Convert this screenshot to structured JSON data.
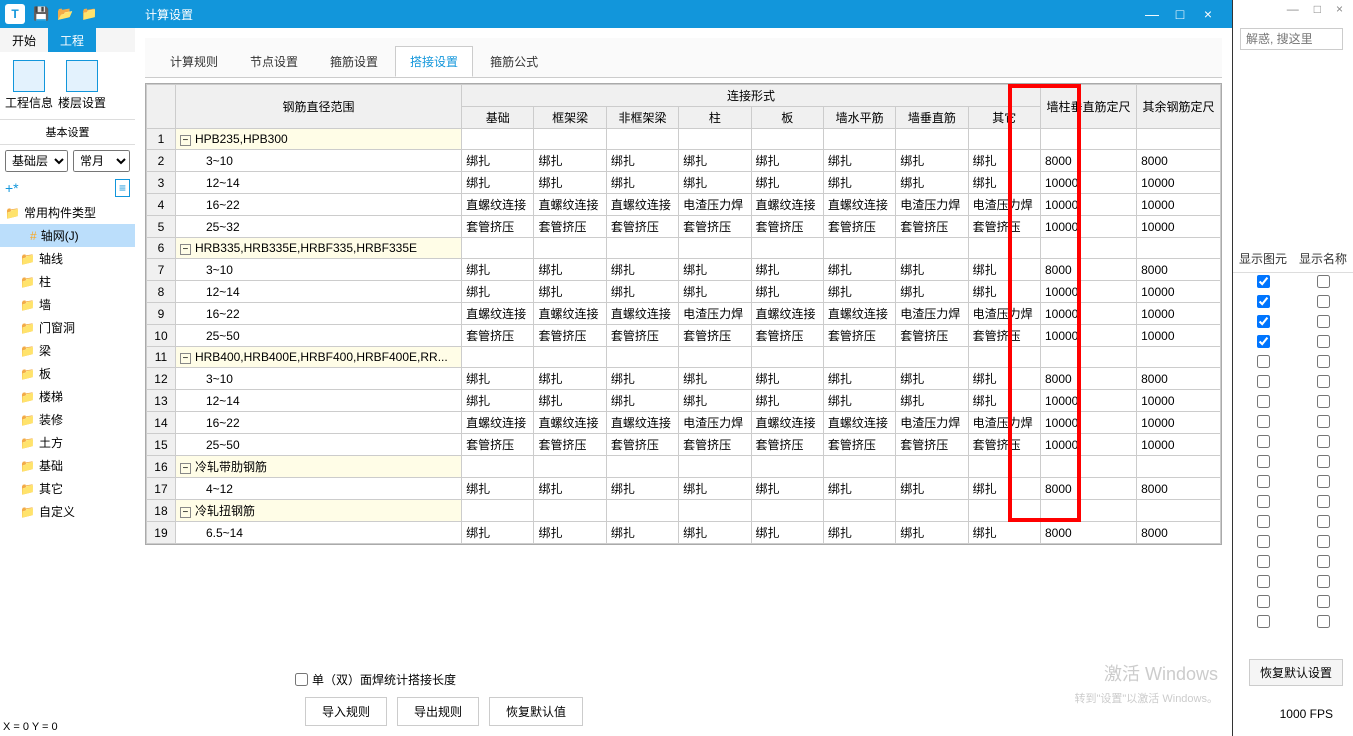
{
  "bg": {
    "min": "—",
    "max": "□",
    "close": "×",
    "search_placeholder": "解惑, 搜这里",
    "rp_col1": "显示图元",
    "rp_col2": "显示名称",
    "restore": "恢复默认设置",
    "fps": "1000 FPS"
  },
  "left": {
    "tabs": [
      "开始",
      "工程"
    ],
    "toolbar": [
      {
        "label": "工程信息"
      },
      {
        "label": "楼层设置"
      }
    ],
    "section": "基本设置",
    "dd1": "基础层",
    "dd2": "常月",
    "tree_group": "常用构件类型",
    "tree": [
      {
        "label": "轴网(J)",
        "sel": true,
        "ic": "#"
      },
      {
        "label": "轴线"
      },
      {
        "label": "柱"
      },
      {
        "label": "墙"
      },
      {
        "label": "门窗洞"
      },
      {
        "label": "梁"
      },
      {
        "label": "板"
      },
      {
        "label": "楼梯"
      },
      {
        "label": "装修"
      },
      {
        "label": "土方"
      },
      {
        "label": "基础"
      },
      {
        "label": "其它"
      },
      {
        "label": "自定义"
      }
    ],
    "status": "X = 0 Y = 0"
  },
  "modal": {
    "title": "计算设置",
    "tabs": [
      "计算规则",
      "节点设置",
      "箍筋设置",
      "搭接设置",
      "箍筋公式"
    ],
    "active_tab": 3,
    "col_group": "连接形式",
    "cols": [
      "钢筋直径范围",
      "基础",
      "框架梁",
      "非框架梁",
      "柱",
      "板",
      "墙水平筋",
      "墙垂直筋",
      "其它",
      "墙柱垂直筋定尺",
      "其余钢筋定尺"
    ],
    "rows": [
      {
        "n": 1,
        "g": true,
        "name": "HPB235,HPB300"
      },
      {
        "n": 2,
        "name": "3~10",
        "c": [
          "绑扎",
          "绑扎",
          "绑扎",
          "绑扎",
          "绑扎",
          "绑扎",
          "绑扎",
          "绑扎"
        ],
        "d1": "8000",
        "d2": "8000"
      },
      {
        "n": 3,
        "name": "12~14",
        "c": [
          "绑扎",
          "绑扎",
          "绑扎",
          "绑扎",
          "绑扎",
          "绑扎",
          "绑扎",
          "绑扎"
        ],
        "d1": "10000",
        "d2": "10000"
      },
      {
        "n": 4,
        "name": "16~22",
        "c": [
          "直螺纹连接",
          "直螺纹连接",
          "直螺纹连接",
          "电渣压力焊",
          "直螺纹连接",
          "直螺纹连接",
          "电渣压力焊",
          "电渣压力焊"
        ],
        "d1": "10000",
        "d2": "10000"
      },
      {
        "n": 5,
        "name": "25~32",
        "c": [
          "套管挤压",
          "套管挤压",
          "套管挤压",
          "套管挤压",
          "套管挤压",
          "套管挤压",
          "套管挤压",
          "套管挤压"
        ],
        "d1": "10000",
        "d2": "10000"
      },
      {
        "n": 6,
        "g": true,
        "name": "HRB335,HRB335E,HRBF335,HRBF335E"
      },
      {
        "n": 7,
        "name": "3~10",
        "c": [
          "绑扎",
          "绑扎",
          "绑扎",
          "绑扎",
          "绑扎",
          "绑扎",
          "绑扎",
          "绑扎"
        ],
        "d1": "8000",
        "d2": "8000"
      },
      {
        "n": 8,
        "name": "12~14",
        "c": [
          "绑扎",
          "绑扎",
          "绑扎",
          "绑扎",
          "绑扎",
          "绑扎",
          "绑扎",
          "绑扎"
        ],
        "d1": "10000",
        "d2": "10000"
      },
      {
        "n": 9,
        "name": "16~22",
        "c": [
          "直螺纹连接",
          "直螺纹连接",
          "直螺纹连接",
          "电渣压力焊",
          "直螺纹连接",
          "直螺纹连接",
          "电渣压力焊",
          "电渣压力焊"
        ],
        "d1": "10000",
        "d2": "10000"
      },
      {
        "n": 10,
        "name": "25~50",
        "c": [
          "套管挤压",
          "套管挤压",
          "套管挤压",
          "套管挤压",
          "套管挤压",
          "套管挤压",
          "套管挤压",
          "套管挤压"
        ],
        "d1": "10000",
        "d2": "10000"
      },
      {
        "n": 11,
        "g": true,
        "name": "HRB400,HRB400E,HRBF400,HRBF400E,RR..."
      },
      {
        "n": 12,
        "name": "3~10",
        "c": [
          "绑扎",
          "绑扎",
          "绑扎",
          "绑扎",
          "绑扎",
          "绑扎",
          "绑扎",
          "绑扎"
        ],
        "d1": "8000",
        "d2": "8000"
      },
      {
        "n": 13,
        "name": "12~14",
        "c": [
          "绑扎",
          "绑扎",
          "绑扎",
          "绑扎",
          "绑扎",
          "绑扎",
          "绑扎",
          "绑扎"
        ],
        "d1": "10000",
        "d2": "10000"
      },
      {
        "n": 14,
        "name": "16~22",
        "c": [
          "直螺纹连接",
          "直螺纹连接",
          "直螺纹连接",
          "电渣压力焊",
          "直螺纹连接",
          "直螺纹连接",
          "电渣压力焊",
          "电渣压力焊"
        ],
        "d1": "10000",
        "d2": "10000"
      },
      {
        "n": 15,
        "name": "25~50",
        "c": [
          "套管挤压",
          "套管挤压",
          "套管挤压",
          "套管挤压",
          "套管挤压",
          "套管挤压",
          "套管挤压",
          "套管挤压"
        ],
        "d1": "10000",
        "d2": "10000"
      },
      {
        "n": 16,
        "g": true,
        "name": "冷轧带肋钢筋"
      },
      {
        "n": 17,
        "name": "4~12",
        "c": [
          "绑扎",
          "绑扎",
          "绑扎",
          "绑扎",
          "绑扎",
          "绑扎",
          "绑扎",
          "绑扎"
        ],
        "d1": "8000",
        "d2": "8000"
      },
      {
        "n": 18,
        "g": true,
        "name": "冷轧扭钢筋"
      },
      {
        "n": 19,
        "name": "6.5~14",
        "c": [
          "绑扎",
          "绑扎",
          "绑扎",
          "绑扎",
          "绑扎",
          "绑扎",
          "绑扎",
          "绑扎"
        ],
        "d1": "8000",
        "d2": "8000"
      }
    ],
    "chk": "单（双）面焊统计搭接长度",
    "btns": [
      "导入规则",
      "导出规则",
      "恢复默认值"
    ]
  },
  "wm1": "激活 Windows",
  "wm2": "转到\"设置\"以激活 Windows。"
}
